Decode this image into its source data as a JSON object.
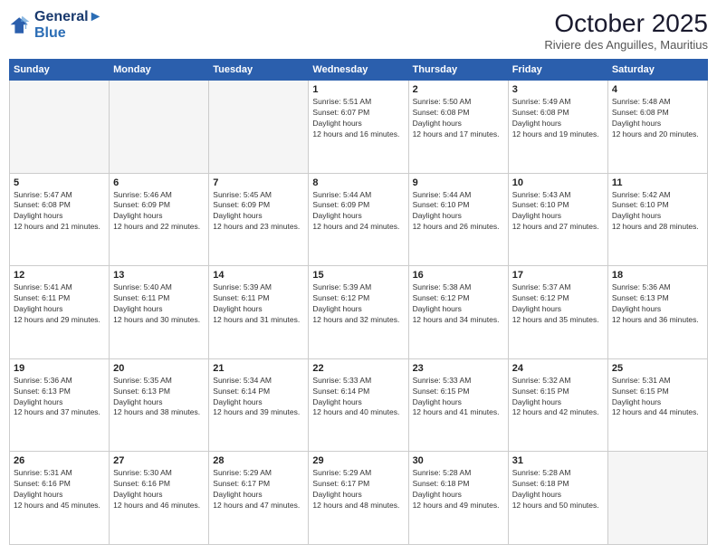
{
  "logo": {
    "line1": "General",
    "line2": "Blue"
  },
  "header": {
    "month": "October 2025",
    "location": "Riviere des Anguilles, Mauritius"
  },
  "weekdays": [
    "Sunday",
    "Monday",
    "Tuesday",
    "Wednesday",
    "Thursday",
    "Friday",
    "Saturday"
  ],
  "weeks": [
    [
      {
        "day": "",
        "empty": true
      },
      {
        "day": "",
        "empty": true
      },
      {
        "day": "",
        "empty": true
      },
      {
        "day": "1",
        "sunrise": "5:51 AM",
        "sunset": "6:07 PM",
        "daylight": "12 hours and 16 minutes."
      },
      {
        "day": "2",
        "sunrise": "5:50 AM",
        "sunset": "6:08 PM",
        "daylight": "12 hours and 17 minutes."
      },
      {
        "day": "3",
        "sunrise": "5:49 AM",
        "sunset": "6:08 PM",
        "daylight": "12 hours and 19 minutes."
      },
      {
        "day": "4",
        "sunrise": "5:48 AM",
        "sunset": "6:08 PM",
        "daylight": "12 hours and 20 minutes."
      }
    ],
    [
      {
        "day": "5",
        "sunrise": "5:47 AM",
        "sunset": "6:08 PM",
        "daylight": "12 hours and 21 minutes."
      },
      {
        "day": "6",
        "sunrise": "5:46 AM",
        "sunset": "6:09 PM",
        "daylight": "12 hours and 22 minutes."
      },
      {
        "day": "7",
        "sunrise": "5:45 AM",
        "sunset": "6:09 PM",
        "daylight": "12 hours and 23 minutes."
      },
      {
        "day": "8",
        "sunrise": "5:44 AM",
        "sunset": "6:09 PM",
        "daylight": "12 hours and 24 minutes."
      },
      {
        "day": "9",
        "sunrise": "5:44 AM",
        "sunset": "6:10 PM",
        "daylight": "12 hours and 26 minutes."
      },
      {
        "day": "10",
        "sunrise": "5:43 AM",
        "sunset": "6:10 PM",
        "daylight": "12 hours and 27 minutes."
      },
      {
        "day": "11",
        "sunrise": "5:42 AM",
        "sunset": "6:10 PM",
        "daylight": "12 hours and 28 minutes."
      }
    ],
    [
      {
        "day": "12",
        "sunrise": "5:41 AM",
        "sunset": "6:11 PM",
        "daylight": "12 hours and 29 minutes."
      },
      {
        "day": "13",
        "sunrise": "5:40 AM",
        "sunset": "6:11 PM",
        "daylight": "12 hours and 30 minutes."
      },
      {
        "day": "14",
        "sunrise": "5:39 AM",
        "sunset": "6:11 PM",
        "daylight": "12 hours and 31 minutes."
      },
      {
        "day": "15",
        "sunrise": "5:39 AM",
        "sunset": "6:12 PM",
        "daylight": "12 hours and 32 minutes."
      },
      {
        "day": "16",
        "sunrise": "5:38 AM",
        "sunset": "6:12 PM",
        "daylight": "12 hours and 34 minutes."
      },
      {
        "day": "17",
        "sunrise": "5:37 AM",
        "sunset": "6:12 PM",
        "daylight": "12 hours and 35 minutes."
      },
      {
        "day": "18",
        "sunrise": "5:36 AM",
        "sunset": "6:13 PM",
        "daylight": "12 hours and 36 minutes."
      }
    ],
    [
      {
        "day": "19",
        "sunrise": "5:36 AM",
        "sunset": "6:13 PM",
        "daylight": "12 hours and 37 minutes."
      },
      {
        "day": "20",
        "sunrise": "5:35 AM",
        "sunset": "6:13 PM",
        "daylight": "12 hours and 38 minutes."
      },
      {
        "day": "21",
        "sunrise": "5:34 AM",
        "sunset": "6:14 PM",
        "daylight": "12 hours and 39 minutes."
      },
      {
        "day": "22",
        "sunrise": "5:33 AM",
        "sunset": "6:14 PM",
        "daylight": "12 hours and 40 minutes."
      },
      {
        "day": "23",
        "sunrise": "5:33 AM",
        "sunset": "6:15 PM",
        "daylight": "12 hours and 41 minutes."
      },
      {
        "day": "24",
        "sunrise": "5:32 AM",
        "sunset": "6:15 PM",
        "daylight": "12 hours and 42 minutes."
      },
      {
        "day": "25",
        "sunrise": "5:31 AM",
        "sunset": "6:15 PM",
        "daylight": "12 hours and 44 minutes."
      }
    ],
    [
      {
        "day": "26",
        "sunrise": "5:31 AM",
        "sunset": "6:16 PM",
        "daylight": "12 hours and 45 minutes."
      },
      {
        "day": "27",
        "sunrise": "5:30 AM",
        "sunset": "6:16 PM",
        "daylight": "12 hours and 46 minutes."
      },
      {
        "day": "28",
        "sunrise": "5:29 AM",
        "sunset": "6:17 PM",
        "daylight": "12 hours and 47 minutes."
      },
      {
        "day": "29",
        "sunrise": "5:29 AM",
        "sunset": "6:17 PM",
        "daylight": "12 hours and 48 minutes."
      },
      {
        "day": "30",
        "sunrise": "5:28 AM",
        "sunset": "6:18 PM",
        "daylight": "12 hours and 49 minutes."
      },
      {
        "day": "31",
        "sunrise": "5:28 AM",
        "sunset": "6:18 PM",
        "daylight": "12 hours and 50 minutes."
      },
      {
        "day": "",
        "empty": true
      }
    ]
  ],
  "labels": {
    "sunrise_prefix": "Sunrise: ",
    "sunset_prefix": "Sunset: ",
    "daylight_label": "Daylight hours"
  }
}
